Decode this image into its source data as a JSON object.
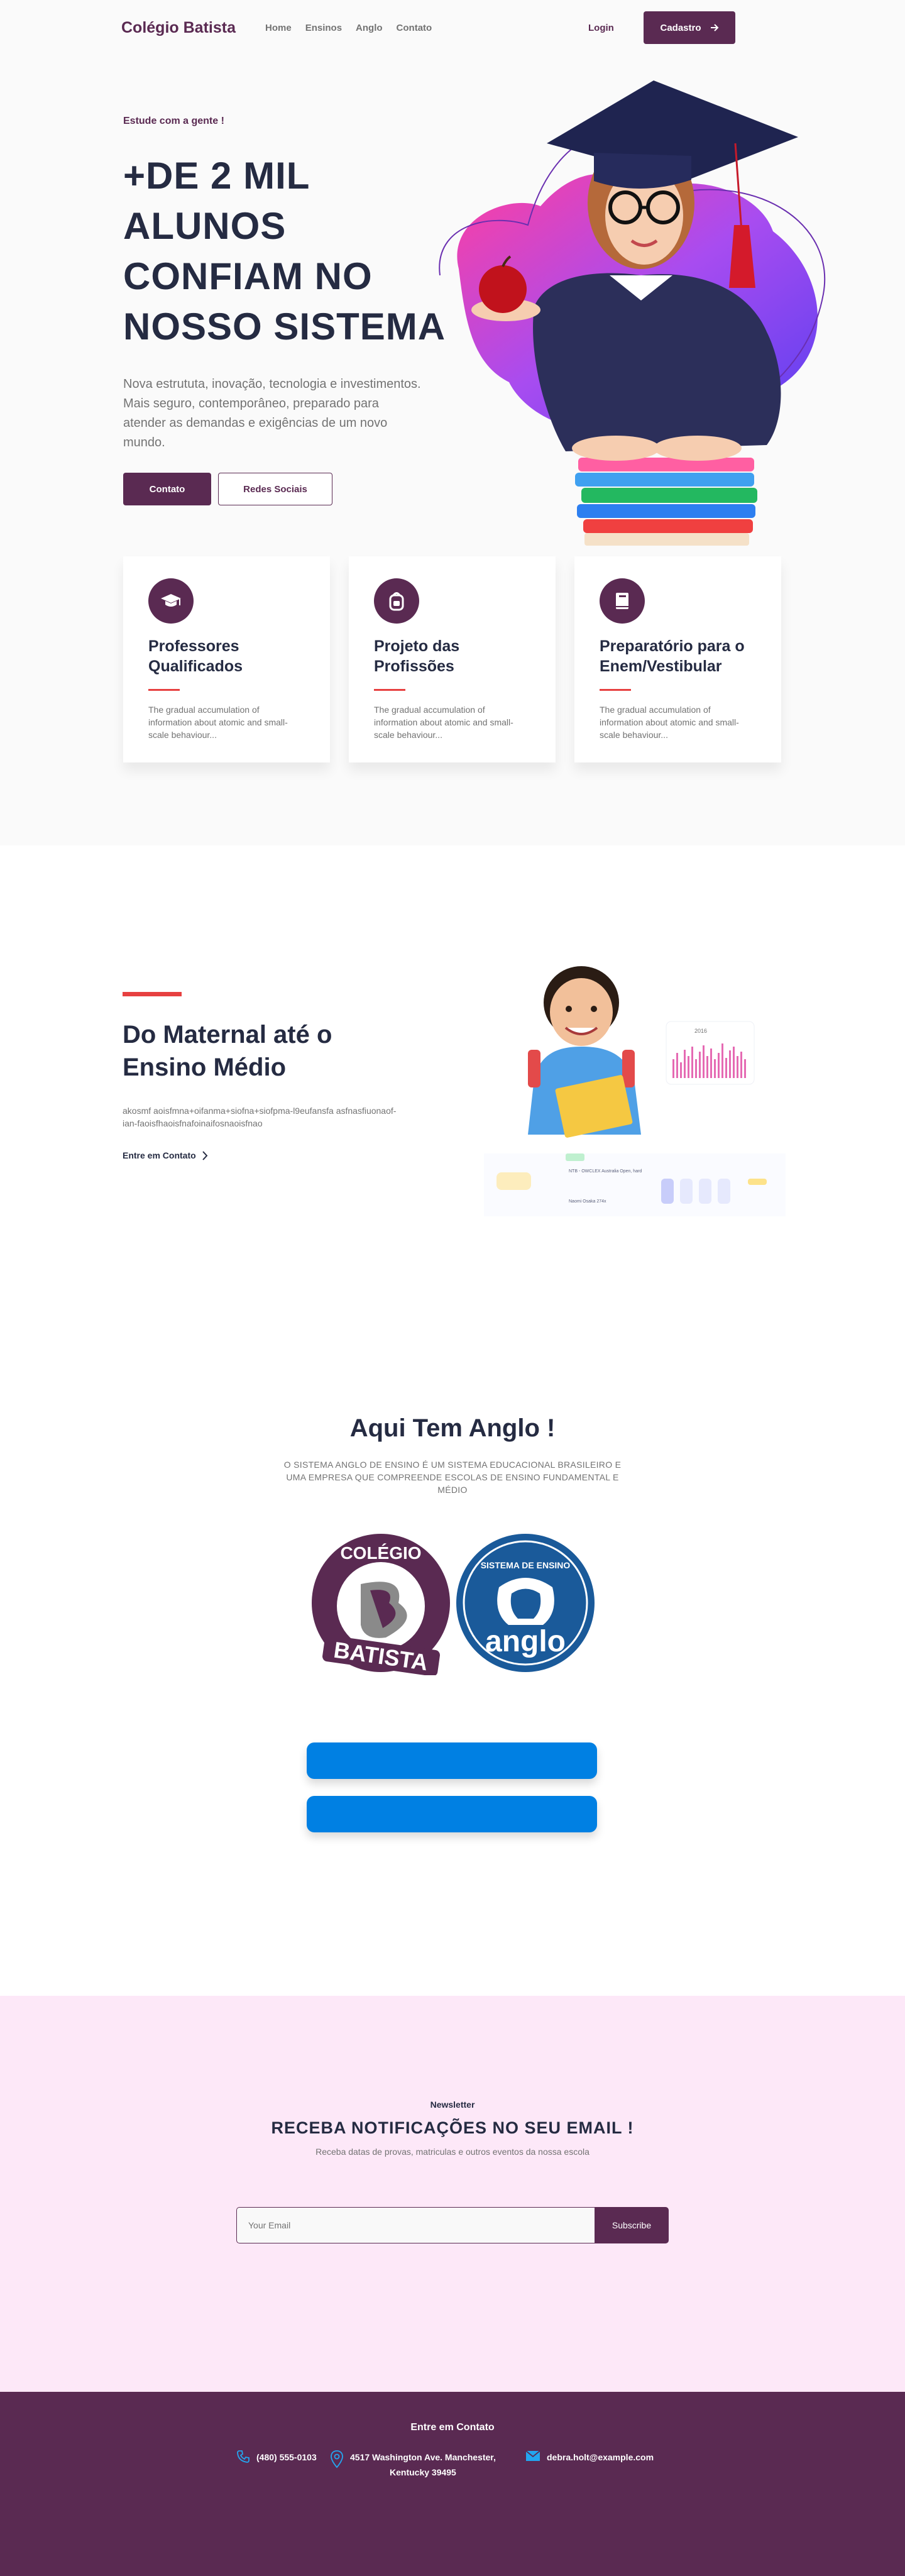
{
  "header": {
    "brand": "Colégio Batista",
    "menu": [
      "Home",
      "Ensinos",
      "Anglo",
      "Contato"
    ],
    "login": "Login",
    "cadastro": "Cadastro"
  },
  "hero": {
    "eyebrow": "Estude com a gente !",
    "title": "+DE 2 MIL ALUNOS CONFIAM NO NOSSO SISTEMA",
    "text": "Nova estrututa, inovação, tecnologia e investimentos. Mais seguro, contemporâneo, preparado para atender as demandas e exigências de um novo mundo.",
    "primary_button": "Contato",
    "secondary_button": "Redes Sociais"
  },
  "cards": [
    {
      "icon": "graduation-cap-icon",
      "title": "Professores Qualificados",
      "text": "The gradual accumulation of information about atomic and small-scale behaviour..."
    },
    {
      "icon": "backpack-icon",
      "title": "Projeto das Profissões",
      "text": "The gradual accumulation of information about atomic and small-scale behaviour..."
    },
    {
      "icon": "book-icon",
      "title": "Preparatório para o Enem/Vestibular",
      "text": "The gradual accumulation of information about atomic and small-scale behaviour..."
    }
  ],
  "section2": {
    "title": "Do Maternal até o Ensino Médio",
    "text": "akosmf aoisfmna+oifanma+siofna+siofpma-l9eufansfa asfnasfiuonaof-ian-faoisfhaoisfnafoinaifosnaoisfnao",
    "link": "Entre em Contato",
    "dash_year": "2016",
    "dash_row1": "NTB - OWCLEX Australia Open, hard",
    "dash_row2": "Naomi Osaka 274x"
  },
  "section3": {
    "title": "Aqui Tem Anglo !",
    "text": "O SISTEMA ANGLO DE ENSINO É UM SISTEMA EDUCACIONAL BRASILEIRO E UMA EMPRESA QUE COMPREENDE ESCOLAS DE ENSINO FUNDAMENTAL E MÉDIO",
    "logo1_top": "COLÉGIO",
    "logo1_bottom": "BATISTA",
    "logo2_top": "SISTEMA DE ENSINO",
    "logo2_bottom": "anglo"
  },
  "newsletter": {
    "eyebrow": "Newsletter",
    "title": "RECEBA NOTIFICAÇÕES NO SEU EMAIL !",
    "text": "Receba datas de provas, matriculas e outros eventos da nossa escola",
    "placeholder": "Your Email",
    "button": "Subscribe"
  },
  "footer": {
    "title": "Entre em Contato",
    "phone": "(480) 555-0103",
    "address_line1": "4517 Washington Ave. Manchester,",
    "address_line2": "Kentucky 39495",
    "email": "debra.holt@example.com"
  },
  "colors": {
    "primary": "#5a2a52",
    "accent_red": "#E74040",
    "blue": "#0080e3",
    "newsletter_bg": "#fde8f8"
  }
}
